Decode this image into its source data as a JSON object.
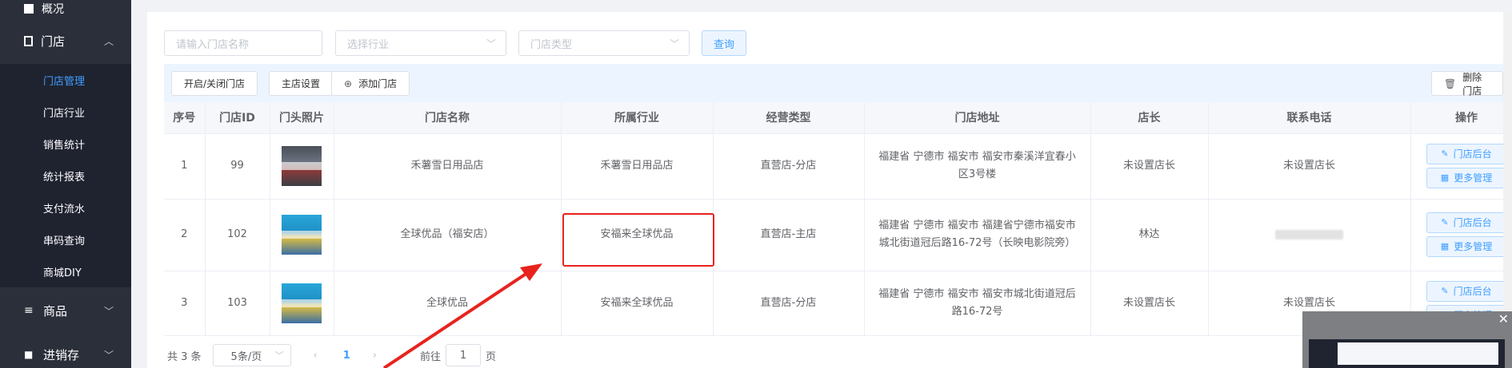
{
  "sidebar": {
    "top_label": "概况",
    "store_menu": "门店",
    "items": [
      {
        "label": "门店管理",
        "active": true
      },
      {
        "label": "门店行业"
      },
      {
        "label": "销售统计"
      },
      {
        "label": "统计报表"
      },
      {
        "label": "支付流水"
      },
      {
        "label": "串码查询"
      },
      {
        "label": "商城DIY"
      }
    ],
    "goods_menu": "商品",
    "inventory_menu": "进销存"
  },
  "filters": {
    "name_placeholder": "请输入门店名称",
    "industry_placeholder": "选择行业",
    "type_placeholder": "门店类型",
    "query_label": "查询"
  },
  "toolbar": {
    "toggle_label": "开启/关闭门店",
    "main_store_label": "主店设置",
    "add_label": "添加门店",
    "delete_label": "删除门店"
  },
  "table": {
    "headers": [
      "序号",
      "门店ID",
      "门头照片",
      "门店名称",
      "所属行业",
      "经营类型",
      "门店地址",
      "店长",
      "联系电话",
      "操作"
    ],
    "rows": [
      {
        "index": "1",
        "id": "99",
        "name": "禾薯雪日用品店",
        "industry": "禾薯雪日用品店",
        "type": "直营店-分店",
        "address": "福建省 宁德市 福安市 福安市秦溪洋宜春小区3号楼",
        "manager": "未设置店长",
        "phone": "未设置店长"
      },
      {
        "index": "2",
        "id": "102",
        "name": "全球优品（福安店）",
        "industry": "安福来全球优品",
        "type": "直营店-主店",
        "address": "福建省 宁德市 福安市 福建省宁德市福安市城北街道冠后路16-72号（长映电影院旁）",
        "manager": "林达",
        "phone": ""
      },
      {
        "index": "3",
        "id": "103",
        "name": "全球优品",
        "industry": "安福来全球优品",
        "type": "直营店-分店",
        "address": "福建省 宁德市 福安市 福安市城北街道冠后路16-72号",
        "manager": "未设置店长",
        "phone": "未设置店长"
      }
    ],
    "op_backend": "门店后台",
    "op_more": "更多管理"
  },
  "pager": {
    "total": "共 3 条",
    "page_size": "5条/页",
    "current": "1",
    "goto": "前往",
    "goto_value": "1",
    "page_unit": "页"
  },
  "colors": {
    "accent": "#409eff",
    "sidebar": "#2b2f3a",
    "highlight": "#e8231d"
  }
}
